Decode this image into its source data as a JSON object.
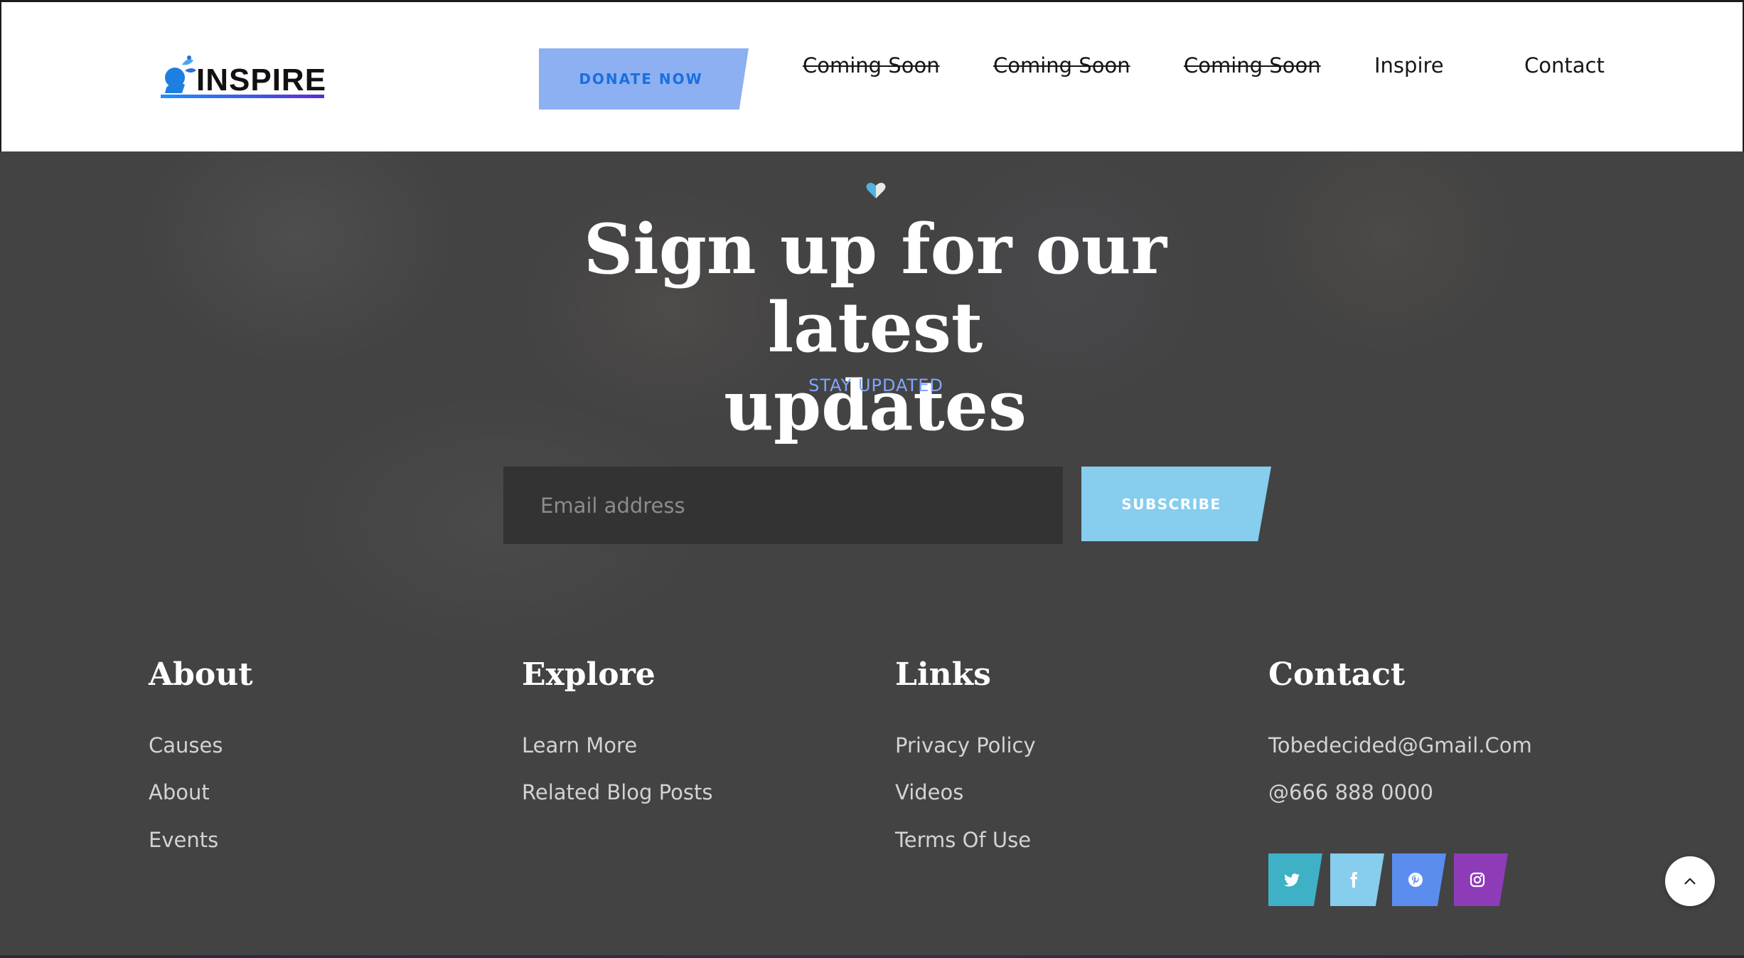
{
  "header": {
    "logo_text": "INSPIRE",
    "donate_label": "DONATE NOW",
    "nav": [
      {
        "label": "Coming Soon",
        "struck": true
      },
      {
        "label": "Coming Soon",
        "struck": true
      },
      {
        "label": "Coming Soon",
        "struck": true
      },
      {
        "label": "Inspire",
        "struck": false
      },
      {
        "label": "Contact",
        "struck": false
      }
    ]
  },
  "signup": {
    "icon": "heart-icon",
    "title_line1": "Sign up for our latest",
    "title_line2": "updates",
    "subtitle": "STAY UPDATED",
    "email_placeholder": "Email address",
    "subscribe_label": "SUBSCRIBE"
  },
  "footer": {
    "about": {
      "title": "About",
      "links": [
        "Causes",
        "About",
        "Events"
      ]
    },
    "explore": {
      "title": "Explore",
      "links": [
        "Learn More",
        "Related Blog Posts"
      ]
    },
    "links": {
      "title": "Links",
      "links": [
        "Privacy Policy",
        "Videos",
        "Terms Of Use"
      ]
    },
    "contact": {
      "title": "Contact",
      "email": "Tobedecided@Gmail.Com",
      "phone": "@666 888 0000",
      "social": [
        {
          "name": "twitter-icon",
          "color": "#3fb1c6"
        },
        {
          "name": "facebook-icon",
          "color": "#86cdee"
        },
        {
          "name": "pinterest-icon",
          "color": "#5b8def"
        },
        {
          "name": "instagram-icon",
          "color": "#8e3bb8"
        }
      ]
    }
  },
  "colors": {
    "accent_blue": "#8db0f2",
    "subscribe": "#86cdee",
    "stay_updated": "#7fa6ff"
  },
  "scroll_top_icon": "chevron-up-icon"
}
